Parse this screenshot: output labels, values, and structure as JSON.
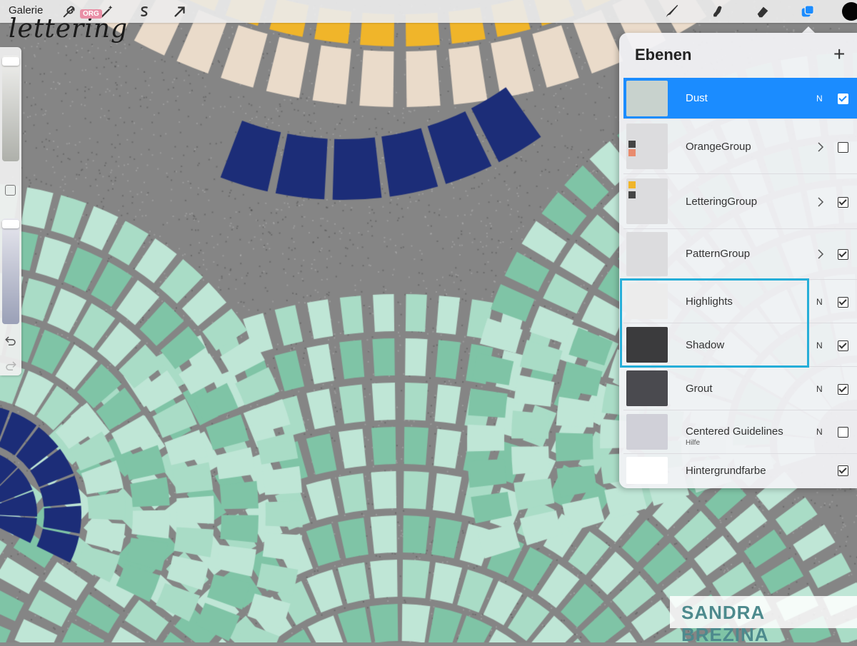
{
  "app": {
    "gallery_label": "Galerie",
    "logo_text": "lettering",
    "logo_badge": "ORG",
    "current_color": "#050505"
  },
  "toolbar": {
    "tools": [
      "wrench-icon",
      "magic-wand-icon",
      "selection-s-icon",
      "move-arrow-icon",
      "brush-icon",
      "smudge-icon",
      "eraser-icon",
      "layers-icon"
    ]
  },
  "layers_panel": {
    "title": "Ebenen",
    "add_label": "+",
    "layers": [
      {
        "name": "Dust",
        "mode": "N",
        "visible": true,
        "active": true
      },
      {
        "name": "OrangeGroup",
        "group": true,
        "visible": false
      },
      {
        "name": "LetteringGroup",
        "group": true,
        "visible": true
      },
      {
        "name": "PatternGroup",
        "group": true,
        "visible": true
      },
      {
        "name": "Highlights",
        "mode": "N",
        "visible": true
      },
      {
        "name": "Shadow",
        "mode": "N",
        "visible": true
      },
      {
        "name": "Grout",
        "mode": "N",
        "visible": true
      },
      {
        "name": "Centered Guidelines",
        "sub": "Hilfe",
        "mode": "N",
        "visible": false
      },
      {
        "name": "Hintergrundfarbe",
        "visible": true
      }
    ]
  },
  "watermark": {
    "text": "SANDRA BREZINA"
  },
  "colors": {
    "accent": "#1b8cff",
    "highlight_box": "#25aed8",
    "tile_mint": "#7fc4a6",
    "tile_mint_light": "#bfe6d6",
    "tile_navy": "#1c2d78",
    "tile_yellow": "#f0b52a",
    "tile_cream": "#eadbca"
  }
}
